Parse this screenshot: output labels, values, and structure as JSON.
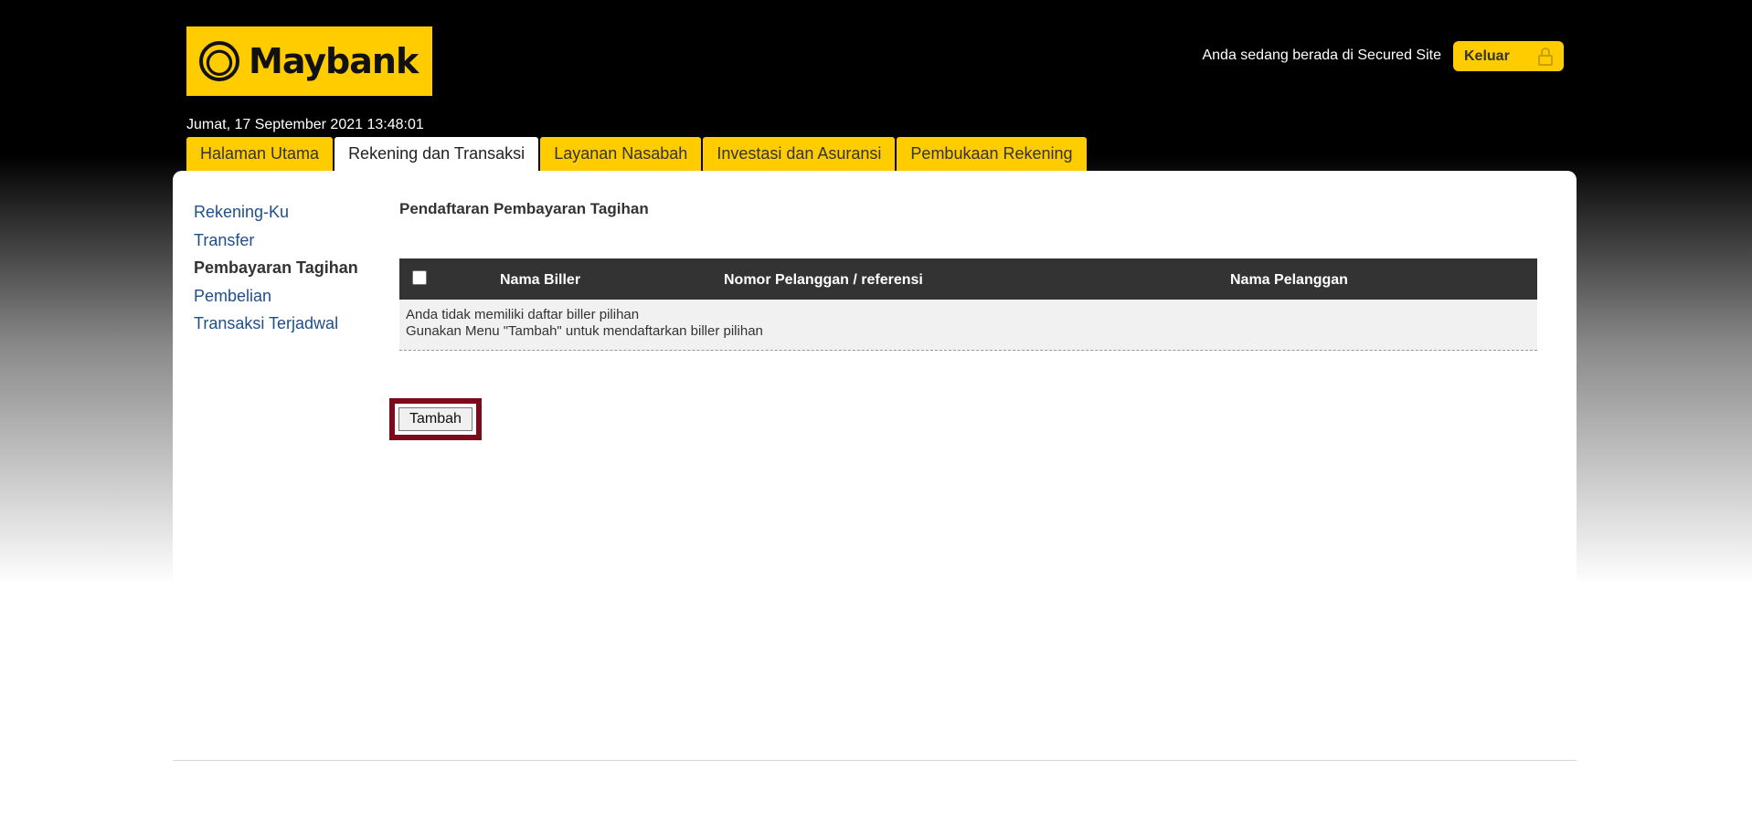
{
  "header": {
    "brand": "Maybank",
    "secured_text": "Anda sedang berada di Secured Site",
    "logout_label": "Keluar",
    "datetime": "Jumat, 17 September 2021 13:48:01"
  },
  "tabs": [
    {
      "label": "Halaman Utama",
      "active": false
    },
    {
      "label": "Rekening dan Transaksi",
      "active": true
    },
    {
      "label": "Layanan Nasabah",
      "active": false
    },
    {
      "label": "Investasi dan Asuransi",
      "active": false
    },
    {
      "label": "Pembukaan Rekening",
      "active": false
    }
  ],
  "sidebar": {
    "items": [
      {
        "label": "Rekening-Ku",
        "active": false
      },
      {
        "label": "Transfer",
        "active": false
      },
      {
        "label": "Pembayaran Tagihan",
        "active": true
      },
      {
        "label": "Pembelian",
        "active": false
      },
      {
        "label": "Transaksi Terjadwal",
        "active": false
      }
    ]
  },
  "main": {
    "title": "Pendaftaran Pembayaran Tagihan",
    "table": {
      "headers": [
        "Nama Biller",
        "Nomor Pelanggan / referensi",
        "Nama Pelanggan"
      ],
      "empty_line1": "Anda tidak memiliki daftar biller pilihan",
      "empty_line2": "Gunakan Menu \"Tambah\" untuk mendaftarkan biller pilihan"
    },
    "add_button": "Tambah"
  },
  "colors": {
    "brand_yellow": "#ffcc00",
    "link_blue": "#1f4e8c",
    "header_dark": "#333333",
    "highlight_border": "#7d0a1c"
  }
}
